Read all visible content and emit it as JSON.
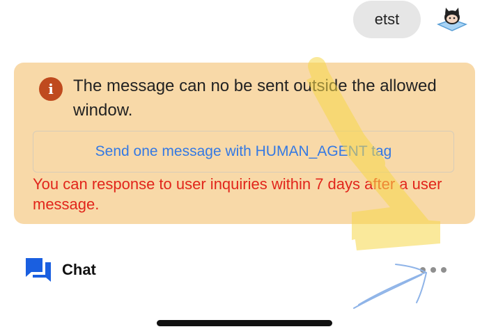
{
  "message": {
    "text": "etst"
  },
  "warning": {
    "icon": "info-icon",
    "icon_glyph": "i",
    "text": "The message can no be sent outside the allowed window.",
    "button_label": "Send one message with HUMAN_AGENT tag",
    "error_text": "You can response to user inquiries within 7 days after a user message.",
    "colors": {
      "panel": "#f8d9a8",
      "icon": "#bf4a1e",
      "link": "#3479e3",
      "error": "#e1251b"
    }
  },
  "bottom_bar": {
    "chat_icon": "chat-bubbles-icon",
    "chat_label": "Chat",
    "more_icon": "more-dots-icon",
    "accent": "#1a5fe0"
  },
  "annotation": {
    "highlight_color": "#f7d84a",
    "arrow_color": "#8fb4e8"
  }
}
